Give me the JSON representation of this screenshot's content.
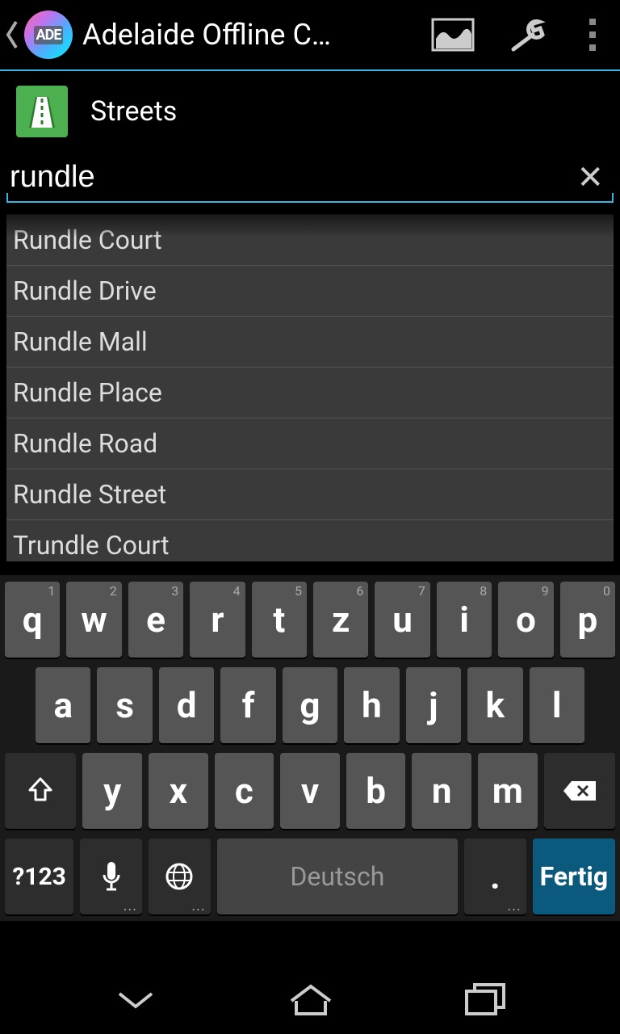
{
  "header": {
    "app_title": "Adelaide Offline C…",
    "app_icon_text": "ADE"
  },
  "category": {
    "label": "Streets"
  },
  "search": {
    "value": "rundle",
    "placeholder": ""
  },
  "results": [
    "Rundle Court",
    "Rundle Drive",
    "Rundle Mall",
    "Rundle Place",
    "Rundle Road",
    "Rundle Street",
    "Trundle Court"
  ],
  "keyboard": {
    "row1": [
      {
        "k": "q",
        "s": "1"
      },
      {
        "k": "w",
        "s": "2"
      },
      {
        "k": "e",
        "s": "3"
      },
      {
        "k": "r",
        "s": "4"
      },
      {
        "k": "t",
        "s": "5"
      },
      {
        "k": "z",
        "s": "6"
      },
      {
        "k": "u",
        "s": "7"
      },
      {
        "k": "i",
        "s": "8"
      },
      {
        "k": "o",
        "s": "9"
      },
      {
        "k": "p",
        "s": "0"
      }
    ],
    "row2": [
      "a",
      "s",
      "d",
      "f",
      "g",
      "h",
      "j",
      "k",
      "l"
    ],
    "row3": [
      "y",
      "x",
      "c",
      "v",
      "b",
      "n",
      "m"
    ],
    "sym_label": "?123",
    "space_label": "Deutsch",
    "period_label": ".",
    "done_label": "Fertig"
  }
}
